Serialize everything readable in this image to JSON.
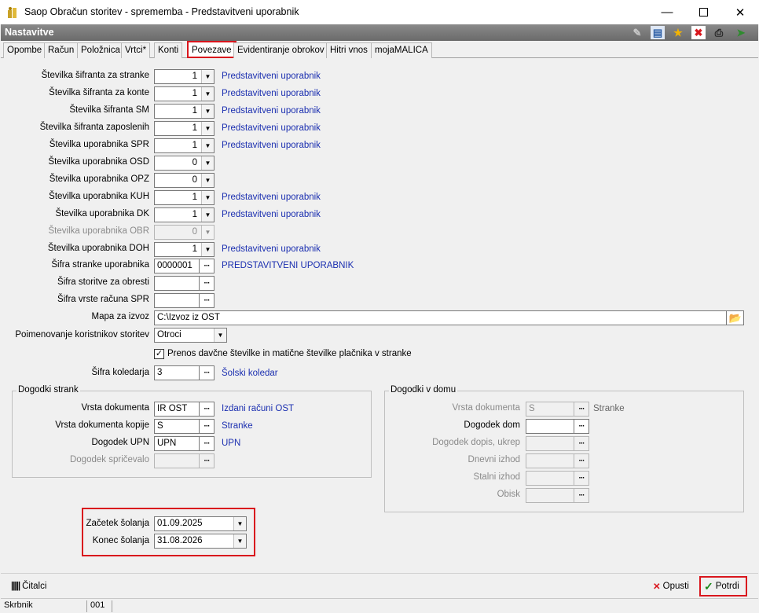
{
  "window": {
    "title": "Saop Obračun storitev - sprememba - Predstavitveni uporabnik",
    "min_icon": "minimize-icon",
    "max_icon": "maximize-icon",
    "close_icon": "close-icon"
  },
  "header": {
    "title": "Nastavitve",
    "icons": [
      "edit-icon",
      "grid-icon",
      "star-icon",
      "delete-icon",
      "print-icon",
      "export-icon"
    ]
  },
  "tabs": [
    "Opombe",
    "Račun",
    "Položnica",
    "Vrtci*",
    "Konti",
    "Povezave",
    "Evidentiranje obrokov",
    "Hitri vnos",
    "mojaMALICA"
  ],
  "active_tab": "Povezave",
  "fields": [
    {
      "label": "Številka šifranta za stranke",
      "value": "1",
      "link": "Predstavitveni uporabnik"
    },
    {
      "label": "Številka šifranta za konte",
      "value": "1",
      "link": "Predstavitveni uporabnik"
    },
    {
      "label": "Številka šifranta SM",
      "value": "1",
      "link": "Predstavitveni uporabnik"
    },
    {
      "label": "Številka šifranta zaposlenih",
      "value": "1",
      "link": "Predstavitveni uporabnik"
    },
    {
      "label": "Številka uporabnika SPR",
      "value": "1",
      "link": "Predstavitveni uporabnik"
    },
    {
      "label": "Številka uporabnika OSD",
      "value": "0",
      "link": ""
    },
    {
      "label": "Številka uporabnika OPZ",
      "value": "0",
      "link": ""
    },
    {
      "label": "Številka uporabnika KUH",
      "value": "1",
      "link": "Predstavitveni uporabnik"
    },
    {
      "label": "Številka uporabnika DK",
      "value": "1",
      "link": "Predstavitveni uporabnik"
    },
    {
      "label": "Številka uporabnika OBR",
      "value": "0",
      "link": ""
    },
    {
      "label": "Številka uporabnika DOH",
      "value": "1",
      "link": "Predstavitveni uporabnik"
    }
  ],
  "sifra_stranke": {
    "label": "Šifra stranke uporabnika",
    "value": "0000001",
    "link": "PREDSTAVITVENI UPORABNIK"
  },
  "sifra_storitve": {
    "label": "Šifra storitve za obresti",
    "value": ""
  },
  "sifra_vrste": {
    "label": "Šifra vrste računa SPR",
    "value": ""
  },
  "mapa": {
    "label": "Mapa za izvoz",
    "value": "C:\\Izvoz iz OST"
  },
  "poimenovanje": {
    "label": "Poimenovanje koristnikov storitev",
    "value": "Otroci"
  },
  "prenos": {
    "label": "Prenos davčne številke in matične številke plačnika v stranke",
    "checked": true
  },
  "koledar": {
    "label": "Šifra koledarja",
    "value": "3",
    "link": "Šolski koledar"
  },
  "dogodki_strank": {
    "title": "Dogodki strank",
    "rows": [
      {
        "label": "Vrsta dokumenta",
        "value": "IR OST",
        "link": "Izdani računi OST"
      },
      {
        "label": "Vrsta dokumenta kopije",
        "value": "S",
        "link": "Stranke"
      },
      {
        "label": "Dogodek UPN",
        "value": "UPN",
        "link": "UPN"
      },
      {
        "label": "Dogodek spričevalo",
        "value": "",
        "link": ""
      }
    ]
  },
  "dogodki_dom": {
    "title": "Dogodki v domu",
    "rows": [
      {
        "label": "Vrsta dokumenta",
        "value": "S",
        "link": "Stranke"
      },
      {
        "label": "Dogodek dom",
        "value": "",
        "link": ""
      },
      {
        "label": "Dogodek dopis, ukrep",
        "value": "",
        "link": ""
      },
      {
        "label": "Dnevni izhod",
        "value": "",
        "link": ""
      },
      {
        "label": "Stalni izhod",
        "value": "",
        "link": ""
      },
      {
        "label": "Obisk",
        "value": "",
        "link": ""
      }
    ]
  },
  "solsko_leto": {
    "zacetek_label": "Začetek šolanja",
    "zacetek": "01.09.2025",
    "konec_label": "Konec šolanja",
    "konec": "31.08.2026"
  },
  "bottom": {
    "citalci": "Čitalci",
    "opusti": "Opusti",
    "potrdi": "Potrdi"
  },
  "status": {
    "user": "Skrbnik",
    "code": "001"
  }
}
